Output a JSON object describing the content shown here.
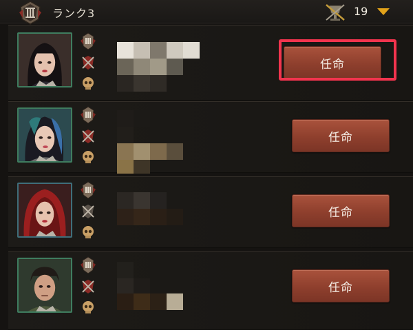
{
  "header": {
    "rank_title": "ランク3",
    "count": "19"
  },
  "rows": [
    {
      "button_label": "任命"
    },
    {
      "button_label": "任命"
    },
    {
      "button_label": "任命"
    },
    {
      "button_label": "任命"
    }
  ],
  "colors": {
    "button": "#8e3f2d",
    "highlight": "#f2344e",
    "dropdown": "#e3a31a"
  },
  "icons": [
    "rank-emblem-icon",
    "chalice-icon",
    "chevron-down-icon",
    "medal-icon",
    "crest-icon",
    "skull-icon"
  ]
}
